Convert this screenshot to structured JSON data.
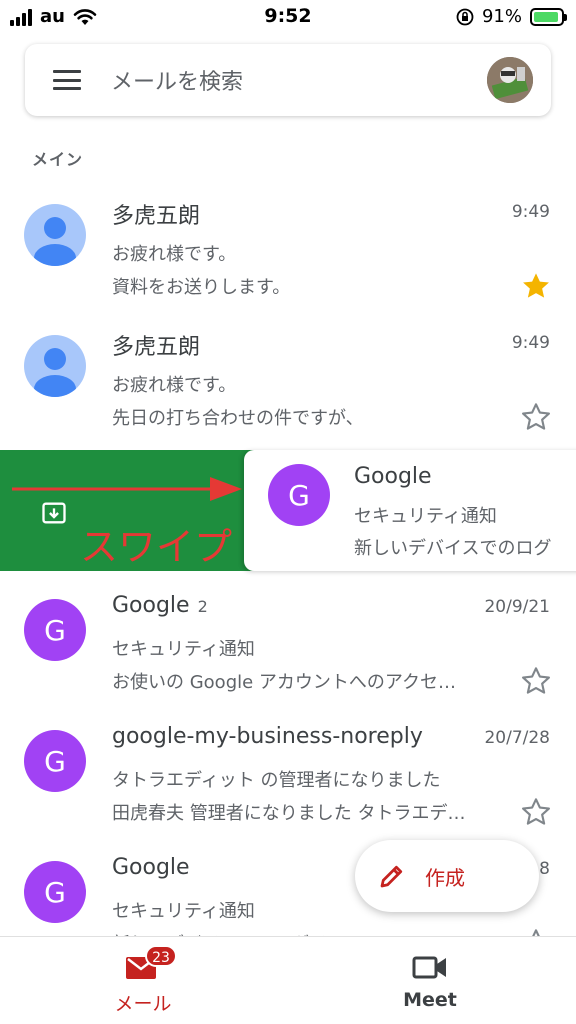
{
  "status_bar": {
    "carrier": "au",
    "time": "9:52",
    "battery_percent": "91%",
    "battery_level": 0.91,
    "icons": [
      "signal-icon",
      "wifi-icon",
      "orientation-lock-icon",
      "battery-charging-icon"
    ]
  },
  "search": {
    "placeholder": "メールを検索",
    "menu_icon": "hamburger-menu-icon",
    "account_icon": "account-avatar"
  },
  "section_label": "メイン",
  "emails": [
    {
      "sender": "多虎五朗",
      "time": "9:49",
      "subject": "お疲れ様です。",
      "snippet": "資料をお送りします。",
      "starred": true,
      "avatar": "person-avatar"
    },
    {
      "sender": "多虎五朗",
      "time": "9:49",
      "subject": "お疲れ様です。",
      "snippet": "先日の打ち合わせの件ですが、",
      "starred": false,
      "avatar": "person-avatar"
    },
    {
      "sender": "Google",
      "avatar_letter": "G",
      "subject": "セキュリティ通知",
      "snippet": "新しいデバイスでのログ",
      "swiped": true
    },
    {
      "sender": "Google",
      "count": "2",
      "avatar_letter": "G",
      "time": "20/9/21",
      "subject": "セキュリティ通知",
      "snippet": "お使いの Google アカウントへのアクセ…",
      "starred": false
    },
    {
      "sender": "google-my-business-noreply",
      "avatar_letter": "G",
      "time": "20/7/28",
      "subject": "タトラエディット の管理者になりました",
      "snippet": "田虎春夫 管理者になりました タトラエデ…",
      "starred": false
    },
    {
      "sender": "Google",
      "avatar_letter": "G",
      "time": "8",
      "subject": "セキュリティ通知",
      "snippet": "新しいデバイスでのログイン tatraharuo",
      "starred": false
    }
  ],
  "swipe_annotation": "スワイプ",
  "swipe_action_icon": "archive-icon",
  "fab": {
    "label": "作成",
    "icon": "pencil-icon"
  },
  "bottom_nav": {
    "mail": {
      "label": "メール",
      "badge": "23",
      "icon": "mail-icon"
    },
    "meet": {
      "label": "Meet",
      "icon": "video-camera-icon"
    }
  },
  "colors": {
    "accent_red": "#c5221f",
    "swipe_green": "#1e8e3e",
    "avatar_purple": "#a142f4",
    "star_yellow": "#f4b400",
    "annotation_red": "#e53935"
  }
}
